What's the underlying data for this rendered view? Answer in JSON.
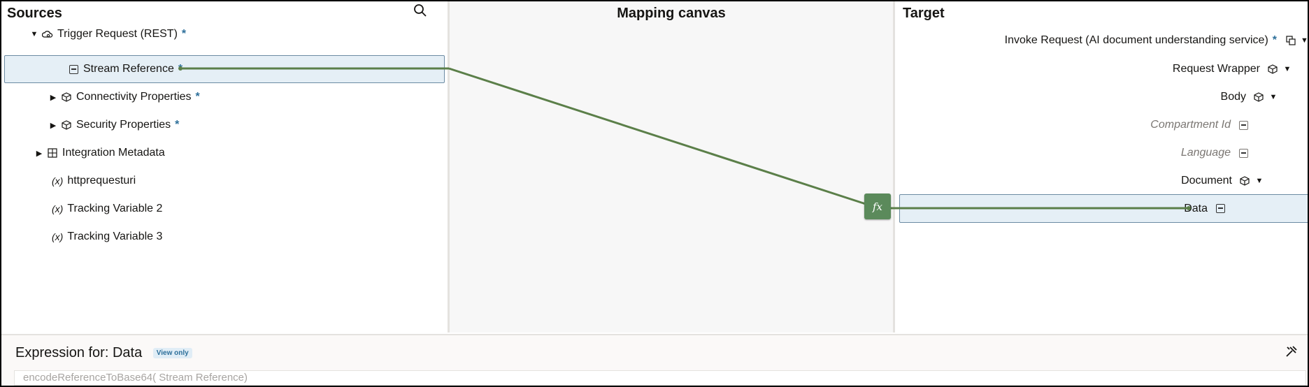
{
  "sources": {
    "title": "Sources",
    "items": [
      {
        "label": "Trigger Request (REST)",
        "required": "*",
        "expand": "▼",
        "icon": "cloud-gear-icon"
      },
      {
        "label": "Stream Reference",
        "required": "*",
        "icon": "text-field-icon",
        "selected": true
      },
      {
        "label": "Connectivity Properties",
        "required": "*",
        "expand": "▶",
        "icon": "cube-icon"
      },
      {
        "label": "Security Properties",
        "required": "*",
        "expand": "▶",
        "icon": "cube-icon"
      },
      {
        "label": "Integration Metadata",
        "expand": "▶",
        "icon": "grid-icon"
      },
      {
        "label": "httprequesturi",
        "var": "(x)"
      },
      {
        "label": "Tracking Variable 2",
        "var": "(x)"
      },
      {
        "label": "Tracking Variable 3",
        "var": "(x)"
      }
    ]
  },
  "canvas": {
    "title": "Mapping canvas",
    "function_label": "fx"
  },
  "target": {
    "title": "Target",
    "items": [
      {
        "label": "Invoke Request (AI document understanding service)",
        "required": "*",
        "icon": "copy-icon",
        "expand": "▼"
      },
      {
        "label": "Request Wrapper",
        "icon": "cube-icon",
        "expand": "▼"
      },
      {
        "label": "Body",
        "icon": "cube-icon",
        "expand": "▼"
      },
      {
        "label": "Compartment Id",
        "icon": "text-field-icon",
        "optional": true
      },
      {
        "label": "Language",
        "icon": "text-field-icon",
        "optional": true
      },
      {
        "label": "Document",
        "icon": "cube-icon",
        "expand": "▼"
      },
      {
        "label": "Data",
        "icon": "text-field-icon",
        "selected": true
      }
    ]
  },
  "expression": {
    "title": "Expression for:",
    "target": "Data",
    "badge": "View only",
    "value": "encodeReferenceToBase64( Stream Reference)"
  },
  "colors": {
    "mapping_line": "#5b7f49",
    "selection": "#e5eff6",
    "required": "#2d6f9a"
  }
}
